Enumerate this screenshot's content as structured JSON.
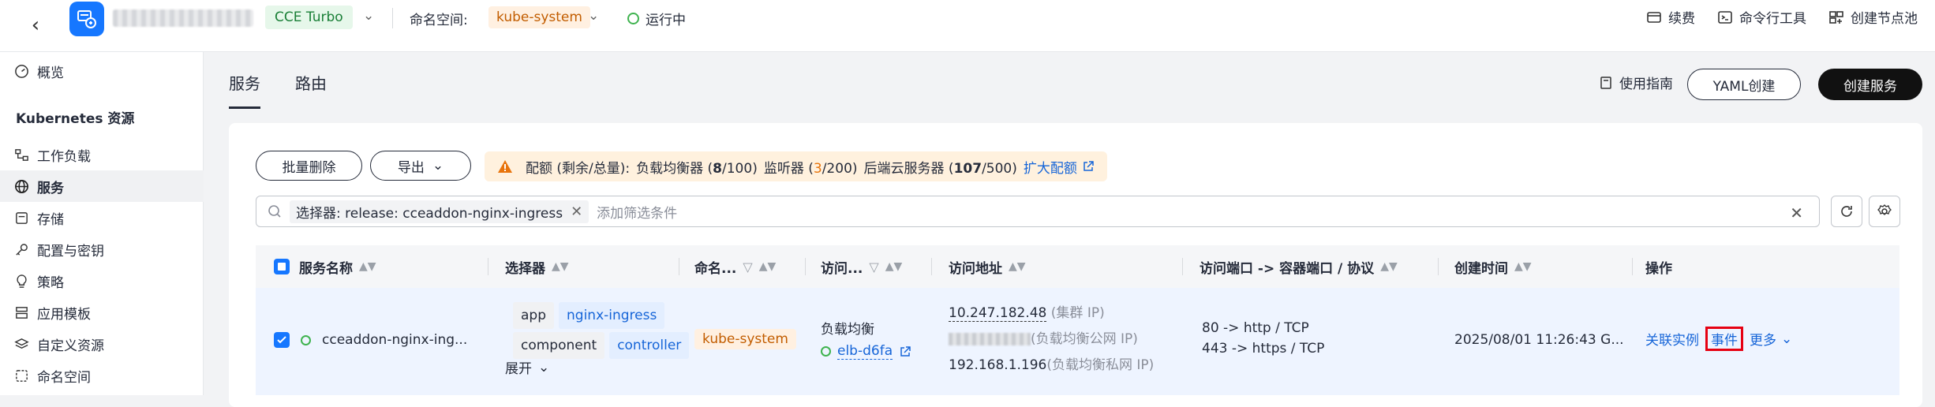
{
  "header": {
    "cluster_type": "CCE Turbo",
    "namespace_label": "命名空间:",
    "namespace_value": "kube-system",
    "status": "运行中",
    "actions": [
      "续费",
      "命令行工具",
      "创建节点池"
    ]
  },
  "sidebar": {
    "overview": "概览",
    "section_title": "Kubernetes 资源",
    "items": [
      {
        "label": "工作负载",
        "icon": "workload-icon"
      },
      {
        "label": "服务",
        "icon": "globe-icon",
        "active": true
      },
      {
        "label": "存储",
        "icon": "storage-icon"
      },
      {
        "label": "配置与密钥",
        "icon": "key-icon"
      },
      {
        "label": "策略",
        "icon": "bulb-icon"
      },
      {
        "label": "应用模板",
        "icon": "template-icon"
      },
      {
        "label": "自定义资源",
        "icon": "layers-icon"
      },
      {
        "label": "命名空间",
        "icon": "namespace-icon"
      }
    ]
  },
  "tabs": [
    "服务",
    "路由"
  ],
  "toolbar": {
    "guide": "使用指南",
    "yaml_create": "YAML创建",
    "create_service": "创建服务"
  },
  "actions": {
    "batch_delete": "批量删除",
    "export": "导出"
  },
  "quota": {
    "prefix": "配额 (剩余/总量):",
    "lb_label": "负载均衡器 (",
    "lb_remaining": "8",
    "lb_total": "/100)",
    "listener_label": "监听器 (",
    "listener_remaining": "3",
    "listener_total": "/200)",
    "backend_label": "后端云服务器 (",
    "backend_remaining": "107",
    "backend_total": "/500)",
    "expand_link": "扩大配额"
  },
  "search": {
    "chip": "选择器: release: cceaddon-nginx-ingress",
    "placeholder": "添加筛选条件"
  },
  "table": {
    "columns": [
      "服务名称",
      "选择器",
      "命名...",
      "访问...",
      "访问地址",
      "访问端口 -> 容器端口 / 协议",
      "创建时间",
      "操作"
    ],
    "row": {
      "name": "cceaddon-nginx-ing...",
      "selector_1_key": "app",
      "selector_1_value": "nginx-ingress",
      "selector_2_key": "component",
      "selector_2_value": "controller",
      "expand": "展开",
      "namespace": "kube-system",
      "access_type": "负载均衡",
      "elb": "elb-d6fa",
      "cluster_ip": "10.247.182.48",
      "cluster_ip_label": "(集群 IP)",
      "public_ip_label": "(负载均衡公网 IP)",
      "private_ip": "192.168.1.196",
      "private_ip_label": "(负载均衡私网 IP)",
      "port_1": "80 -> http / TCP",
      "port_2": "443 -> https / TCP",
      "created": "2025/08/01 11:26:43 G...",
      "op_instances": "关联实例",
      "op_events": "事件",
      "op_more": "更多"
    }
  }
}
